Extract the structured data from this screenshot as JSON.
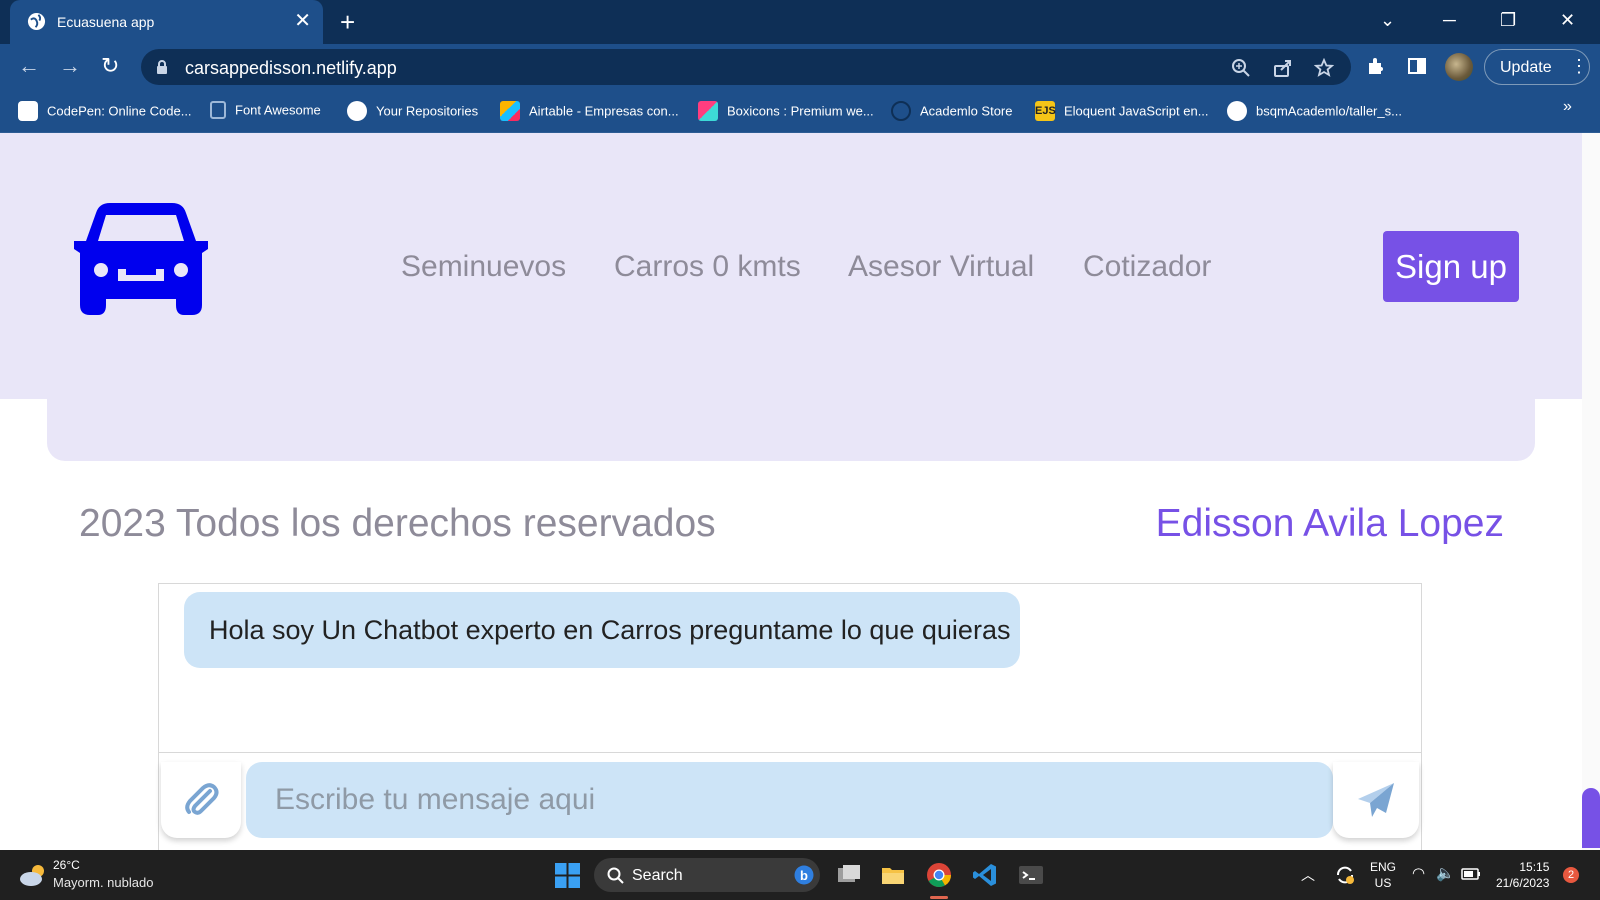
{
  "browser": {
    "tab_title": "Ecuasuena app",
    "url": "carsappedisson.netlify.app",
    "update_label": "Update",
    "bookmarks": [
      {
        "label": "CodePen: Online Code...",
        "icon": "codepen-icon"
      },
      {
        "label": "Font Awesome",
        "icon": "flag-icon"
      },
      {
        "label": "Your Repositories",
        "icon": "github-icon"
      },
      {
        "label": "Airtable - Empresas con...",
        "icon": "airtable-icon"
      },
      {
        "label": "Boxicons : Premium we...",
        "icon": "boxicons-icon"
      },
      {
        "label": "Academlo Store",
        "icon": "academlo-icon"
      },
      {
        "label": "Eloquent JavaScript en...",
        "icon": "ejs-icon"
      },
      {
        "label": "bsqmAcademlo/taller_s...",
        "icon": "github-icon"
      }
    ],
    "bookmarks_overflow": "»"
  },
  "site": {
    "nav": [
      "Seminuevos",
      "Carros 0 kmts",
      "Asesor Virtual",
      "Cotizador"
    ],
    "signup_label": "Sign up",
    "footer_text": "2023 Todos los derechos reservados",
    "author": "Edisson Avila Lopez",
    "brand_color": "#0000ee",
    "accent_color": "#7751e6"
  },
  "chat": {
    "bot_message": "Hola soy Un Chatbot experto en Carros preguntame lo que quieras",
    "input_placeholder": "Escribe tu mensaje aqui"
  },
  "taskbar": {
    "temperature": "26°C",
    "weather": "Mayorm. nublado",
    "search_label": "Search",
    "lang_top": "ENG",
    "lang_bottom": "US",
    "time": "15:15",
    "date": "21/6/2023",
    "notifications": "2"
  }
}
